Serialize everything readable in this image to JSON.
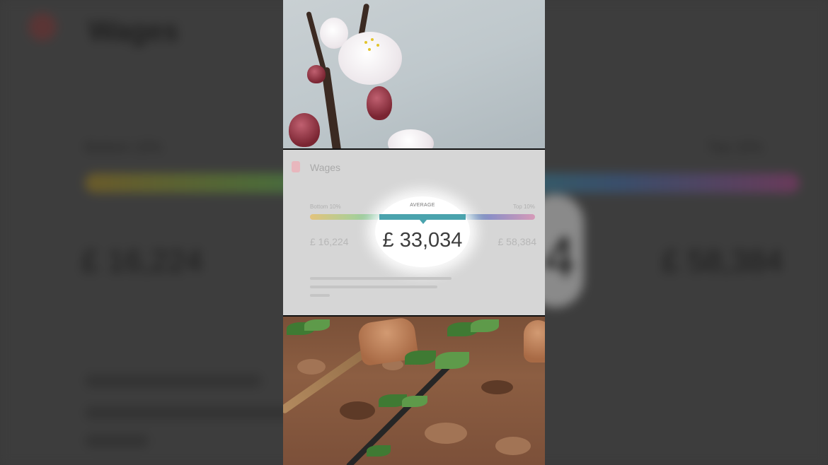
{
  "card": {
    "title": "Wages",
    "low_label": "Bottom 10%",
    "high_label": "Top 10%",
    "avg_label": "AVERAGE",
    "low_value": "£ 16,224",
    "avg_value": "£ 33,034",
    "high_value": "£ 58,384",
    "colors": {
      "bar_start": "#e3c37c",
      "bar_mid": "#4aa3ad",
      "bar_end": "#d69ab8"
    }
  },
  "background": {
    "title": "Wages",
    "low_value": "£ 16,224",
    "high_value": "£ 58,384",
    "partial_digit": "4"
  },
  "icons": {
    "card_icon": "pin-icon"
  }
}
